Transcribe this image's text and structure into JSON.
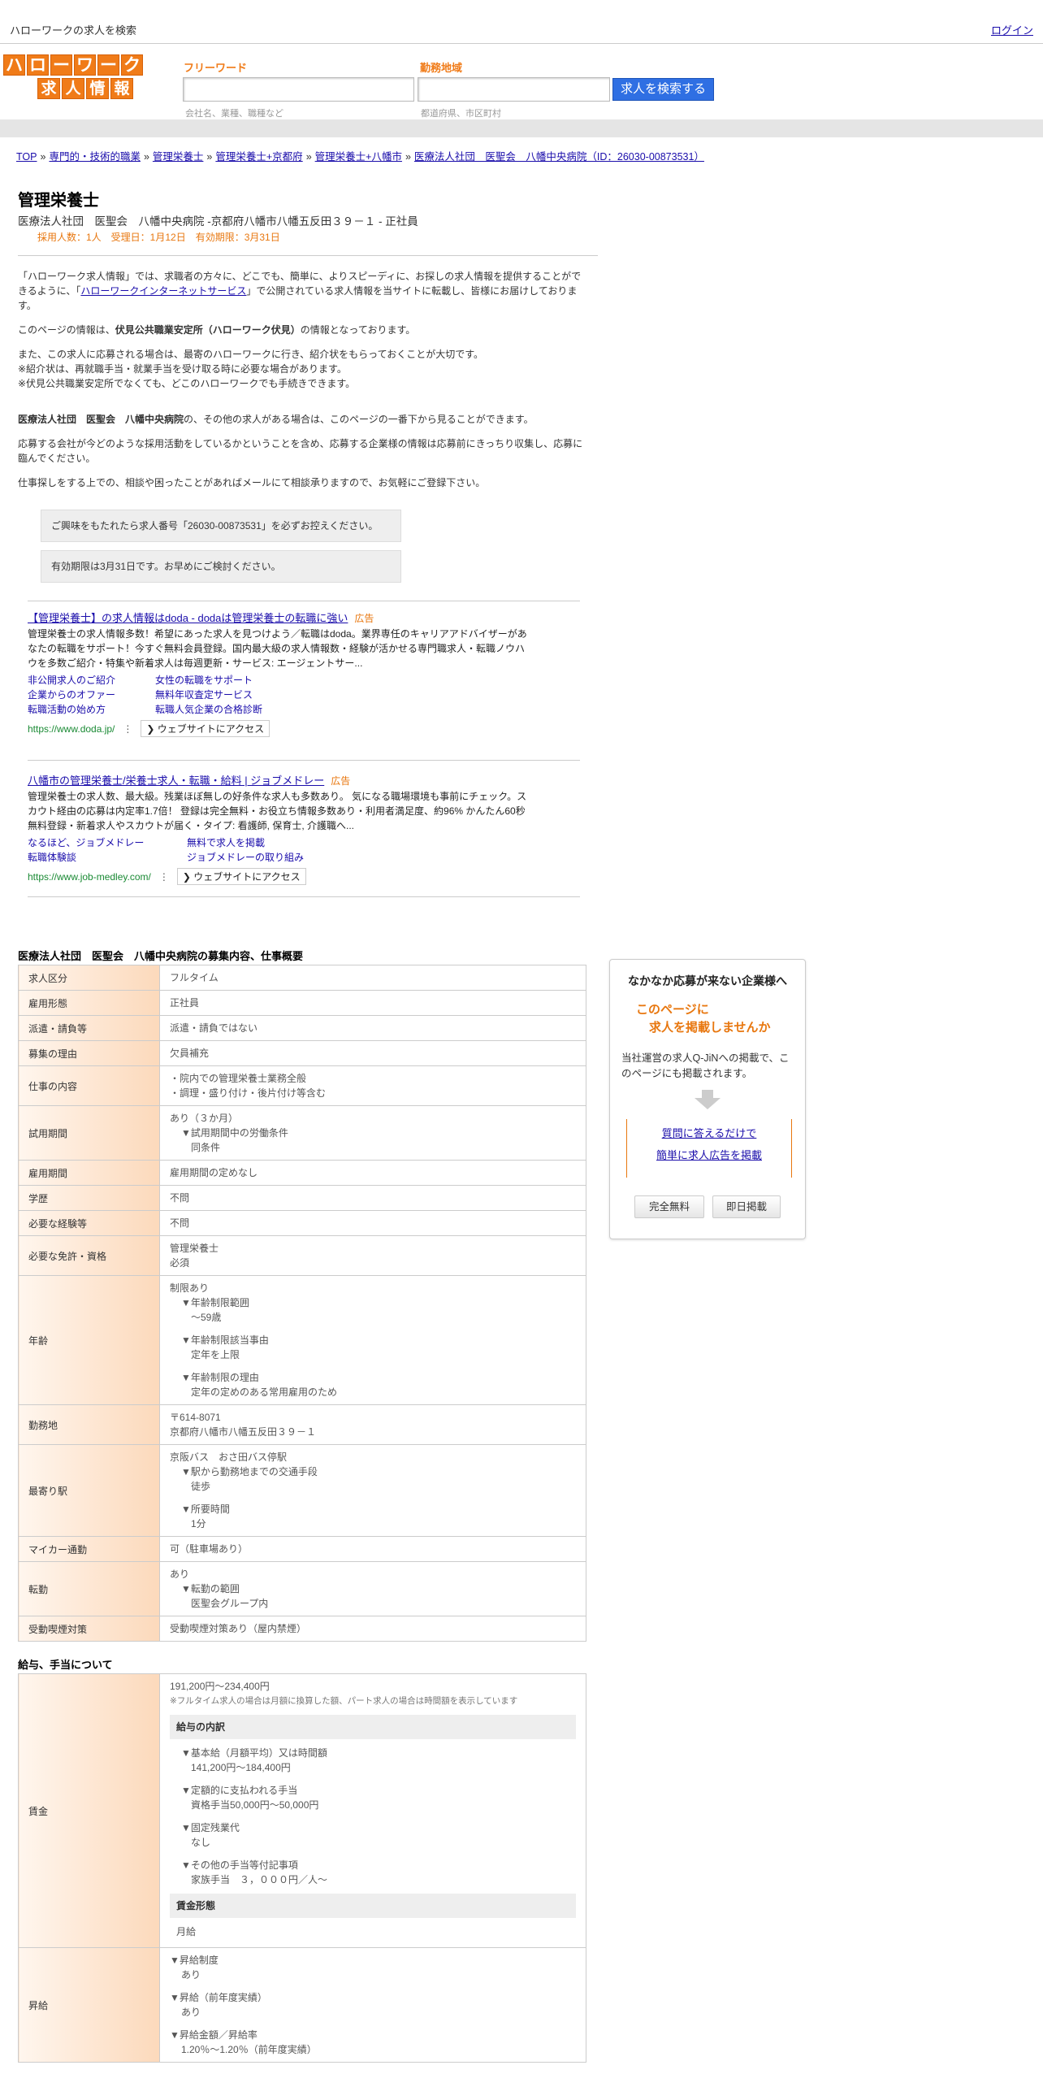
{
  "topbar": {
    "site_title": "ハローワークの求人を検索",
    "login": "ログイン"
  },
  "logo": {
    "row1": [
      "ハ",
      "ロ",
      "ー",
      "ワ",
      "ー",
      "ク"
    ],
    "row2": [
      "求",
      "人",
      "情",
      "報"
    ]
  },
  "search": {
    "freeword_label": "フリーワード",
    "freeword_placeholder": "会社名、業種、職種など",
    "area_label": "勤務地域",
    "area_placeholder": "都道府県、市区町村",
    "button": "求人を検索する"
  },
  "breadcrumb": [
    "TOP",
    "専門的・技術的職業",
    "管理栄養士",
    "管理栄養士+京都府",
    "管理栄養士+八幡市",
    "医療法人社団　医聖会　八幡中央病院（ID：26030-00873531）"
  ],
  "job": {
    "title": "管理栄養士",
    "company_line": "医療法人社団　医聖会　八幡中央病院 -京都府八幡市八幡五反田３９－１ - 正社員",
    "meta": "採用人数：1人　受理日：1月12日　有効期限：3月31日"
  },
  "intro": {
    "p1_a": "「ハローワーク求人情報」では、求職者の方々に、どこでも、簡単に、よりスピーディに、お探しの求人情報を提供することができるように、「",
    "p1_link": "ハローワークインターネットサービス",
    "p1_b": "」で公開されている求人情報を当サイトに転載し、皆様にお届けしております。",
    "p2_a": "このページの情報は、",
    "p2_bold": "伏見公共職業安定所（ハローワーク伏見）",
    "p2_b": "の情報となっております。",
    "p3": "また、この求人に応募される場合は、最寄のハローワークに行き、紹介状をもらっておくことが大切です。",
    "p4": "※紹介状は、再就職手当・就業手当を受け取る時に必要な場合があります。",
    "p5": "※伏見公共職業安定所でなくても、どこのハローワークでも手続きできます。",
    "p6_bold": "医療法人社団　医聖会　八幡中央病院",
    "p6_b": "の、その他の求人がある場合は、このページの一番下から見ることができます。",
    "p7": "応募する会社が今どのような採用活動をしているかということを含め、応募する企業様の情報は応募前にきっちり収集し、応募に臨んでください。",
    "p8": "仕事探しをする上での、相談や困ったことがあればメールにて相談承りますので、お気軽にご登録下さい。"
  },
  "notes": [
    "ご興味をもたれたら求人番号「26030-00873531」を必ずお控えください。",
    "有効期限は3月31日です。お早めにご検討ください。"
  ],
  "ads": [
    {
      "title": "【管理栄養士】の求人情報はdoda - dodaは管理栄養士の転職に強い",
      "tag": "広告",
      "desc": "管理栄養士の求人情報多数！希望にあった求人を見つけよう／転職はdoda。業界専任のキャリアアドバイザーがあなたの転職をサポート！今すぐ無料会員登録。国内最大級の求人情報数・経験が活かせる専門職求人・転職ノウハウを多数ご紹介・特集や新着求人は毎週更新・サービス: エージェントサー...",
      "links": [
        "非公開求人のご紹介",
        "女性の転職をサポート",
        "企業からのオファー",
        "無料年収査定サービス",
        "転職活動の始め方",
        "転職人気企業の合格診断"
      ],
      "url": "https://www.doda.jp/",
      "visit": "❯ ウェブサイトにアクセス"
    },
    {
      "title": "八幡市の管理栄養士/栄養士求人・転職・給料 | ジョブメドレー",
      "tag": "広告",
      "desc": "管理栄養士の求人数、最大級。残業ほぼ無しの好条件な求人も多数あり。 気になる職場環境も事前にチェック。スカウト経由の応募は内定率1.7倍！ 登録は完全無料・お役立ち情報多数あり・利用者満足度、約96% かんたん60秒無料登録・新着求人やスカウトが届く・タイプ: 看護師, 保育士, 介護職へ...",
      "links": [
        "なるほど、ジョブメドレー",
        "無料で求人を掲載",
        "転職体験談",
        "ジョブメドレーの取り組み"
      ],
      "url": "https://www.job-medley.com/",
      "visit": "❯ ウェブサイトにアクセス"
    }
  ],
  "section1_title": "医療法人社団　医聖会　八幡中央病院の募集内容、仕事概要",
  "table1": {
    "r1": {
      "k": "求人区分",
      "v": "フルタイム"
    },
    "r2": {
      "k": "雇用形態",
      "v": "正社員"
    },
    "r3": {
      "k": "派遣・請負等",
      "v": "派遣・請負ではない"
    },
    "r4": {
      "k": "募集の理由",
      "v": "欠員補充"
    },
    "r5": {
      "k": "仕事の内容",
      "v1": "・院内での管理栄養士業務全般",
      "v2": "・調理・盛り付け・後片付け等含む"
    },
    "r6": {
      "k": "試用期間",
      "v1": "あり（３か月）",
      "v2": "▼試用期間中の労働条件",
      "v3": "同条件"
    },
    "r7": {
      "k": "雇用期間",
      "v": "雇用期間の定めなし"
    },
    "r8": {
      "k": "学歴",
      "v": "不問"
    },
    "r9": {
      "k": "必要な経験等",
      "v": "不問"
    },
    "r10": {
      "k": "必要な免許・資格",
      "v1": "管理栄養士",
      "v2": "必須"
    },
    "r11": {
      "k": "年齢",
      "v1": "制限あり",
      "v2": "▼年齢制限範囲",
      "v3": "〜59歳",
      "v4": "▼年齢制限該当事由",
      "v5": "定年を上限",
      "v6": "▼年齢制限の理由",
      "v7": "定年の定めのある常用雇用のため"
    },
    "r12": {
      "k": "勤務地",
      "v1": "〒614-8071",
      "v2": "京都府八幡市八幡五反田３９－１"
    },
    "r13": {
      "k": "最寄り駅",
      "v1": "京阪バス　おさ田バス停駅",
      "v2": "▼駅から勤務地までの交通手段",
      "v3": "徒歩",
      "v4": "▼所要時間",
      "v5": "1分"
    },
    "r14": {
      "k": "マイカー通勤",
      "v": "可（駐車場あり）"
    },
    "r15": {
      "k": "転勤",
      "v1": "あり",
      "v2": "▼転勤の範囲",
      "v3": "医聖会グループ内"
    },
    "r16": {
      "k": "受動喫煙対策",
      "v": "受動喫煙対策あり（屋内禁煙）"
    }
  },
  "section2_title": "給与、手当について",
  "table2": {
    "wage": {
      "k": "賃金",
      "range": "191,200円〜234,400円",
      "note": "※フルタイム求人の場合は月額に換算した額、パート求人の場合は時間額を表示しています",
      "breakdown_title": "給与の内訳",
      "b1": "▼基本給（月額平均）又は時間額",
      "b1v": "141,200円〜184,400円",
      "b2": "▼定額的に支払われる手当",
      "b2v": "資格手当50,000円〜50,000円",
      "b3": "▼固定残業代",
      "b3v": "なし",
      "b4": "▼その他の手当等付記事項",
      "b4v": "家族手当　３，０００円／人～",
      "form_title": "賃金形態",
      "form_v": "月給"
    },
    "raise": {
      "k": "昇給",
      "a": "▼昇給制度",
      "av": "あり",
      "b": "▼昇給（前年度実績）",
      "bv": "あり",
      "c": "▼昇給金額／昇給率",
      "cv": "1.20％〜1.20％（前年度実績）"
    }
  },
  "sidebox": {
    "title": "なかなか応募が来ない企業様へ",
    "h1": "このページに",
    "h2": "求人を掲載しませんか",
    "desc": "当社運営の求人Q-JiNへの掲載で、このページにも掲載されます。",
    "link1": "質問に答えるだけで",
    "link2": "簡単に求人広告を掲載",
    "btn1": "完全無料",
    "btn2": "即日掲載"
  }
}
